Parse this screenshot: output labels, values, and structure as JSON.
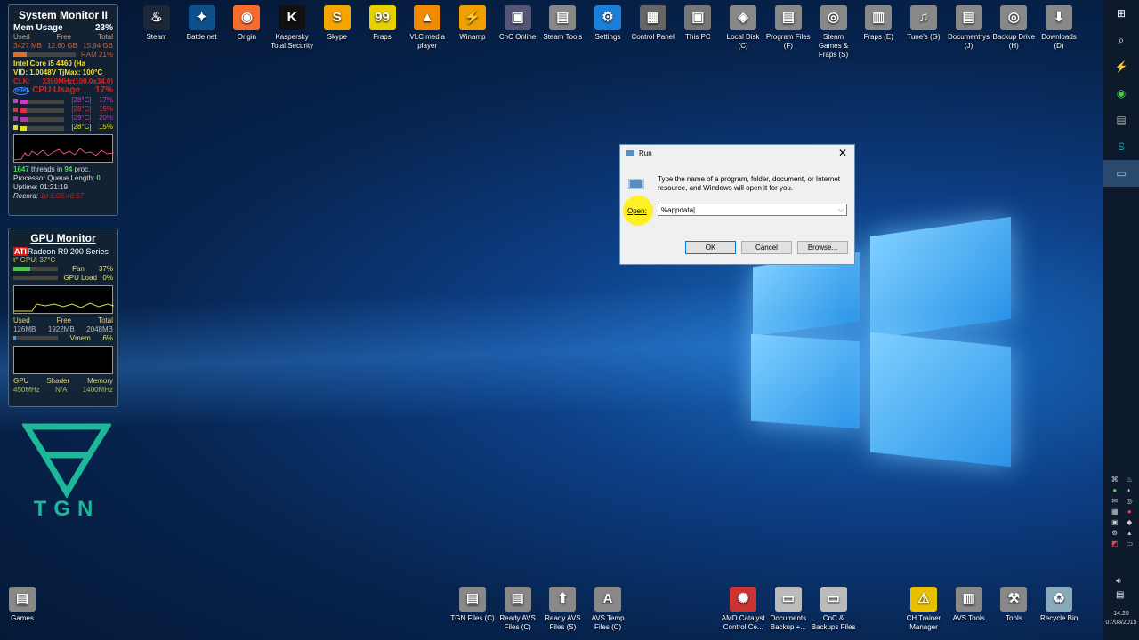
{
  "desktop": {
    "top_icons": [
      {
        "label": "Steam",
        "color": "#1b2838",
        "glyph": "♨"
      },
      {
        "label": "Battle.net",
        "color": "#0e4f8c",
        "glyph": "✦"
      },
      {
        "label": "Origin",
        "color": "#f56c2d",
        "glyph": "◉"
      },
      {
        "label": "Kaspersky Total Security",
        "color": "#111",
        "glyph": "K"
      },
      {
        "label": "Skype",
        "color": "#f5a400",
        "glyph": "S"
      },
      {
        "label": "Fraps",
        "color": "#e8d000",
        "glyph": "99"
      },
      {
        "label": "VLC media player",
        "color": "#f08a00",
        "glyph": "▲"
      },
      {
        "label": "Winamp",
        "color": "#f0a000",
        "glyph": "⚡"
      },
      {
        "label": "CnC Online",
        "color": "#557",
        "glyph": "▣"
      },
      {
        "label": "Steam Tools",
        "color": "#888",
        "glyph": "▤"
      },
      {
        "label": "Settings",
        "color": "#1a7fd8",
        "glyph": "⚙"
      },
      {
        "label": "Control Panel",
        "color": "#666",
        "glyph": "▦"
      },
      {
        "label": "This PC",
        "color": "#777",
        "glyph": "▣"
      },
      {
        "label": "Local Disk (C)",
        "color": "#888",
        "glyph": "◈"
      },
      {
        "label": "Program Files (F)",
        "color": "#888",
        "glyph": "▤"
      },
      {
        "label": "Steam Games & Fraps (S)",
        "color": "#888",
        "glyph": "◎"
      },
      {
        "label": "Fraps (E)",
        "color": "#888",
        "glyph": "▥"
      },
      {
        "label": "Tune's (G)",
        "color": "#888",
        "glyph": "♫"
      },
      {
        "label": "Documentrys (J)",
        "color": "#888",
        "glyph": "▤"
      },
      {
        "label": "Backup Drive (H)",
        "color": "#888",
        "glyph": "◎"
      },
      {
        "label": "Downloads (D)",
        "color": "#888",
        "glyph": "⬇"
      }
    ],
    "bottom_left": [
      {
        "label": "Games",
        "color": "#888",
        "glyph": "▤"
      }
    ],
    "bottom_icons": [
      {
        "label": "TGN Files (C)",
        "color": "#888",
        "glyph": "▤",
        "slot": 0
      },
      {
        "label": "Ready AVS Files (C)",
        "color": "#888",
        "glyph": "▤",
        "slot": 1
      },
      {
        "label": "Ready AVS Files (S)",
        "color": "#888",
        "glyph": "⬆",
        "slot": 2
      },
      {
        "label": "AVS Temp Files (C)",
        "color": "#888",
        "glyph": "A",
        "slot": 3
      },
      {
        "label": "AMD Catalyst Control Ce...",
        "color": "#c33",
        "glyph": "✺",
        "slot": 6
      },
      {
        "label": "Documents Backup +...",
        "color": "#bbb",
        "glyph": "▭",
        "slot": 7
      },
      {
        "label": "CnC & Backups Files",
        "color": "#bbb",
        "glyph": "▭",
        "slot": 8
      },
      {
        "label": "CH Trainer Manager",
        "color": "#e8c000",
        "glyph": "⚠",
        "slot": 10
      },
      {
        "label": "AVS Tools",
        "color": "#888",
        "glyph": "▥",
        "slot": 11
      },
      {
        "label": "Tools",
        "color": "#888",
        "glyph": "⚒",
        "slot": 12
      },
      {
        "label": "Recycle Bin",
        "color": "#8ab",
        "glyph": "♻",
        "slot": 13
      }
    ]
  },
  "sysmon": {
    "title": "System Monitor II",
    "mem_label": "Mem Usage",
    "mem_pct": "23%",
    "cols": [
      "Used",
      "Free",
      "Total"
    ],
    "mem_vals": [
      "3427 MB",
      "12.60 GB",
      "15.94 GB"
    ],
    "ram_label": "RAM",
    "ram_pct": "21%",
    "ram_fill": 21,
    "cpu_name": "Intel Core i5 4460 (Ha",
    "vid": "VID: 1.0048V TjMax: 100°C",
    "clk_label": "CLK:",
    "clk": "3399MHz(100.0x34.0)",
    "cpu_label": "CPU Usage",
    "cpu_pct": "17%",
    "cores": [
      {
        "temp": "[28°C]",
        "pct": "17%",
        "fill": 17,
        "color": "#c040c0"
      },
      {
        "temp": "[28°C]",
        "pct": "15%",
        "fill": 15,
        "color": "#e03040"
      },
      {
        "temp": "[29°C]",
        "pct": "20%",
        "fill": 20,
        "color": "#a040a0"
      },
      {
        "temp": "[28°C]",
        "pct": "15%",
        "fill": 15,
        "color": "#e0e020"
      }
    ],
    "threads": "1647",
    "threads_text": "threads in",
    "procs": "94",
    "procs_text": "proc.",
    "pql_label": "Processor Queue Length:",
    "pql": "0",
    "uptime": "Uptime: 01:21:19",
    "record_label": "Record:",
    "record": "1d 6:06:46:57"
  },
  "gpumon": {
    "title": "GPU Monitor",
    "brand": "ATI",
    "name": "Radeon R9 200 Series",
    "temp": "t° GPU: 37°C",
    "fan_label": "Fan",
    "fan_pct": "37%",
    "fan_fill": 37,
    "load_label": "GPU Load",
    "load_pct": "0%",
    "load_fill": 0,
    "cols": [
      "Used",
      "Free",
      "Total"
    ],
    "vals": [
      "126MB",
      "1922MB",
      "2048MB"
    ],
    "vmem_label": "Vmem",
    "vmem_pct": "6%",
    "vmem_fill": 6,
    "clk_cols": [
      "GPU",
      "Shader",
      "Memory"
    ],
    "clk_vals": [
      "450MHz",
      "N/A",
      "1400MHz"
    ]
  },
  "logo": {
    "text": "TGN"
  },
  "run": {
    "title": "Run",
    "desc": "Type the name of a program, folder, document, or Internet resource, and Windows will open it for you.",
    "open_label": "Open:",
    "value": "%appdata",
    "ok": "OK",
    "cancel": "Cancel",
    "browse": "Browse..."
  },
  "taskbar": {
    "time": "14:20",
    "date": "07/08/2015"
  }
}
